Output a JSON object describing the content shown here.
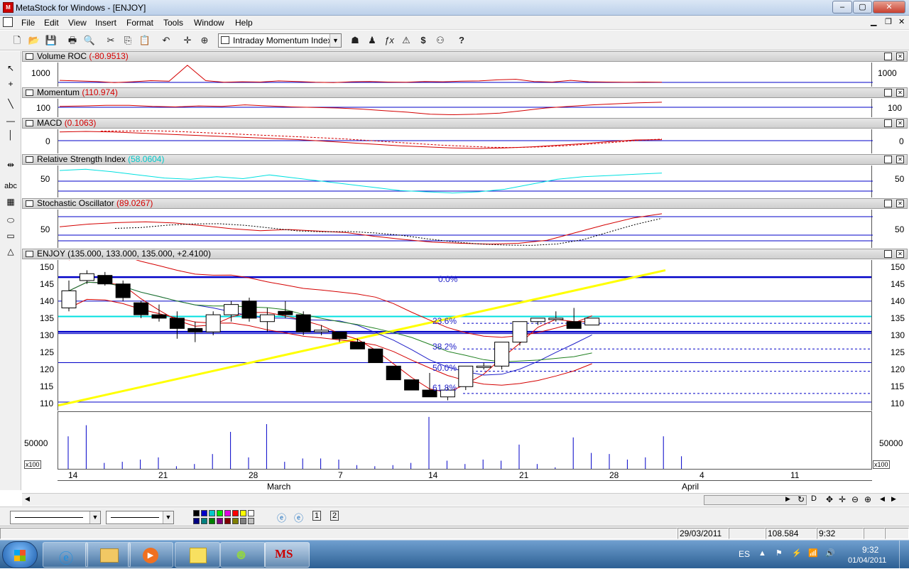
{
  "window": {
    "title": "MetaStock for Windows - [ENJOY]"
  },
  "menu": [
    "File",
    "Edit",
    "View",
    "Insert",
    "Format",
    "Tools",
    "Window",
    "Help"
  ],
  "toolbar": {
    "indicator_select": "Intraday Momentum Index"
  },
  "panels": [
    {
      "name": "Volume ROC",
      "value": "(-80.9513)",
      "value_color": "#d40000",
      "y_label": "1000"
    },
    {
      "name": "Momentum",
      "value": "(110.974)",
      "value_color": "#d40000",
      "y_label": "100"
    },
    {
      "name": "MACD",
      "value": "(0.1063)",
      "value_color": "#d40000",
      "y_label": "0"
    },
    {
      "name": "Relative Strength Index",
      "value": "(58.0604)",
      "value_color": "#00c8c8",
      "y_label": "50"
    },
    {
      "name": "Stochastic Oscillator",
      "value": "(89.0267)",
      "value_color": "#d40000",
      "y_label": "50"
    },
    {
      "name": "ENJOY",
      "value": "(135.000, 133.000, 135.000, +2.4100)",
      "value_color": "#000000"
    }
  ],
  "price_axis": [
    "150",
    "145",
    "140",
    "135",
    "130",
    "125",
    "120",
    "115",
    "110"
  ],
  "fibonacci": [
    "0.0%",
    "23.6%",
    "38.2%",
    "50.0%",
    "61.8%"
  ],
  "volume": {
    "y_label": "50000",
    "multiplier": "x100"
  },
  "x_axis": {
    "days": [
      "14",
      "21",
      "28",
      "7",
      "14",
      "21",
      "28",
      "4",
      "11"
    ],
    "months": [
      "March",
      "April"
    ]
  },
  "status": {
    "date": "29/03/2011",
    "value": "108.584",
    "time": "9:32"
  },
  "taskbar": {
    "lang": "ES",
    "clock_time": "9:32",
    "clock_date": "01/04/2011",
    "ms_logo": "MS"
  },
  "colors": {
    "price_down": "#000000",
    "price_up": "#ffffff",
    "trend": "#ffff00",
    "support": "#0000c8",
    "resistance": "#00e0e0",
    "ma_red": "#d40000"
  },
  "chart_data": {
    "type": "candlestick",
    "title": "ENJOY",
    "ylim": [
      108,
      152
    ],
    "last": {
      "high": 135.0,
      "low": 133.0,
      "close": 135.0,
      "change": 2.41
    },
    "candles": [
      {
        "o": 138.0,
        "h": 146.0,
        "l": 137.0,
        "c": 143.0
      },
      {
        "o": 146.0,
        "h": 149.0,
        "l": 145.0,
        "c": 148.0
      },
      {
        "o": 147.5,
        "h": 148.5,
        "l": 144.5,
        "c": 145.0
      },
      {
        "o": 145.0,
        "h": 146.0,
        "l": 140.0,
        "c": 141.0
      },
      {
        "o": 139.5,
        "h": 140.0,
        "l": 135.0,
        "c": 136.0
      },
      {
        "o": 136.0,
        "h": 139.0,
        "l": 134.0,
        "c": 135.0
      },
      {
        "o": 135.0,
        "h": 137.0,
        "l": 129.0,
        "c": 132.0
      },
      {
        "o": 132.0,
        "h": 134.0,
        "l": 128.0,
        "c": 131.0
      },
      {
        "o": 131.0,
        "h": 137.0,
        "l": 130.0,
        "c": 136.0
      },
      {
        "o": 136.0,
        "h": 140.0,
        "l": 134.0,
        "c": 139.0
      },
      {
        "o": 140.0,
        "h": 141.0,
        "l": 134.0,
        "c": 135.0
      },
      {
        "o": 134.0,
        "h": 138.0,
        "l": 131.0,
        "c": 136.0
      },
      {
        "o": 137.0,
        "h": 140.0,
        "l": 135.0,
        "c": 136.0
      },
      {
        "o": 136.0,
        "h": 137.0,
        "l": 130.0,
        "c": 131.0
      },
      {
        "o": 131.0,
        "h": 133.0,
        "l": 130.0,
        "c": 131.5
      },
      {
        "o": 131.0,
        "h": 131.0,
        "l": 128.0,
        "c": 129.0
      },
      {
        "o": 128.0,
        "h": 129.0,
        "l": 126.0,
        "c": 126.0
      },
      {
        "o": 126.0,
        "h": 126.0,
        "l": 122.0,
        "c": 122.0
      },
      {
        "o": 121.0,
        "h": 121.0,
        "l": 117.0,
        "c": 117.0
      },
      {
        "o": 117.0,
        "h": 117.0,
        "l": 114.0,
        "c": 114.0
      },
      {
        "o": 114.0,
        "h": 119.0,
        "l": 112.0,
        "c": 112.0
      },
      {
        "o": 112.0,
        "h": 115.0,
        "l": 111.0,
        "c": 114.0
      },
      {
        "o": 115.0,
        "h": 121.0,
        "l": 114.0,
        "c": 121.0
      },
      {
        "o": 121.0,
        "h": 122.0,
        "l": 120.0,
        "c": 121.0
      },
      {
        "o": 121.0,
        "h": 128.0,
        "l": 120.0,
        "c": 128.0
      },
      {
        "o": 128.0,
        "h": 134.0,
        "l": 127.0,
        "c": 134.0
      },
      {
        "o": 134.0,
        "h": 135.0,
        "l": 133.0,
        "c": 135.0
      },
      {
        "o": 135.0,
        "h": 137.0,
        "l": 134.0,
        "c": 135.0
      },
      {
        "o": 134.0,
        "h": 138.0,
        "l": 132.0,
        "c": 132.0
      },
      {
        "o": 133.0,
        "h": 135.0,
        "l": 133.0,
        "c": 135.0
      }
    ],
    "volume": [
      60000,
      80000,
      12000,
      14000,
      18000,
      22000,
      6000,
      10000,
      28000,
      68000,
      22000,
      82000,
      14000,
      20000,
      20000,
      18000,
      8000,
      6000,
      8000,
      12000,
      95000,
      16000,
      10000,
      18000,
      16000,
      45000,
      10000,
      4000,
      58000,
      30000,
      28000,
      18000,
      22000,
      60000,
      24000,
      0
    ],
    "series": [
      {
        "name": "Volume ROC",
        "values": [
          10,
          8,
          6,
          2,
          5,
          9,
          7,
          65,
          9,
          3,
          5,
          4,
          8,
          6,
          3,
          2,
          5,
          6,
          4,
          3,
          6,
          5,
          7,
          8,
          12,
          14,
          6,
          4,
          10,
          5,
          4,
          3,
          4,
          3
        ]
      },
      {
        "name": "Momentum",
        "values": [
          103,
          104,
          105,
          105,
          103,
          102,
          104,
          103,
          106,
          104,
          102,
          101,
          100,
          98,
          95,
          92,
          88,
          87,
          88,
          90,
          95,
          100,
          103,
          106,
          108,
          110,
          111
        ]
      },
      {
        "name": "MACD",
        "values": [
          3.0,
          3.2,
          3.0,
          2.6,
          2.2,
          1.8,
          1.4,
          1.0,
          0.6,
          0.2,
          -0.4,
          -1.0,
          -1.6,
          -2.2,
          -2.6,
          -3.0,
          -3.2,
          -3.0,
          -2.6,
          -2.0,
          -1.4,
          -0.6,
          0.0,
          0.1
        ]
      },
      {
        "name": "Relative Strength Index",
        "values": [
          62,
          64,
          60,
          55,
          50,
          48,
          52,
          49,
          55,
          50,
          45,
          40,
          35,
          30,
          28,
          26,
          28,
          32,
          40,
          48,
          52,
          54,
          56,
          58
        ]
      },
      {
        "name": "Stochastic Oscillator",
        "values": [
          55,
          62,
          66,
          68,
          65,
          58,
          50,
          45,
          48,
          44,
          40,
          30,
          22,
          15,
          12,
          10,
          12,
          20,
          40,
          60,
          78,
          89
        ]
      }
    ]
  }
}
